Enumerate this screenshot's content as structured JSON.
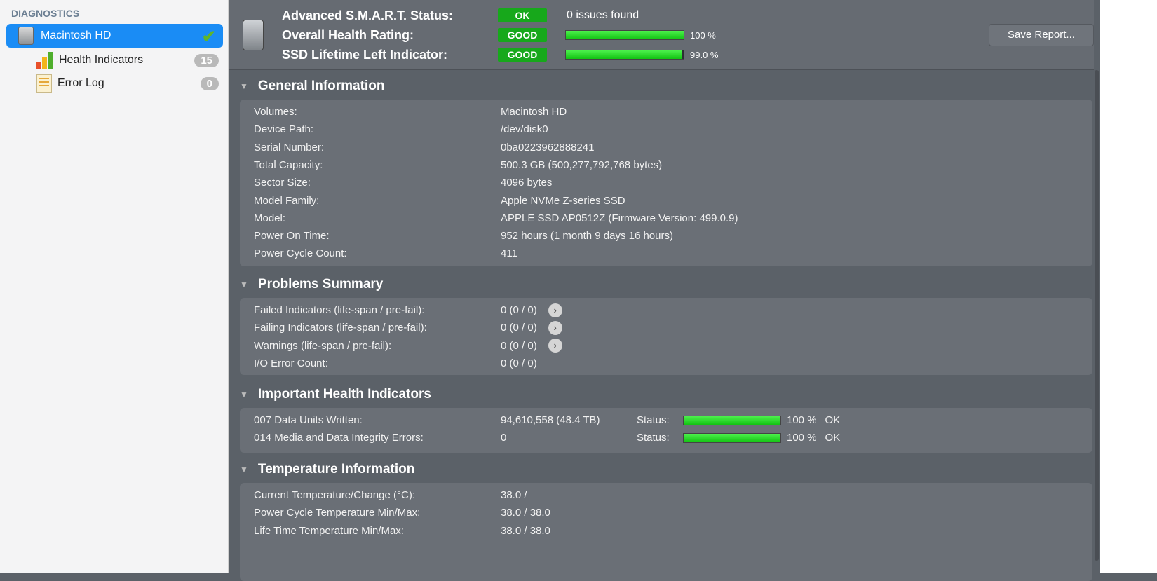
{
  "sidebar": {
    "heading": "DIAGNOSTICS",
    "disk": "Macintosh HD",
    "items": [
      {
        "label": "Health Indicators",
        "count": "15"
      },
      {
        "label": "Error Log",
        "count": "0"
      }
    ]
  },
  "header": {
    "rows": [
      {
        "label": "Advanced S.M.A.R.T. Status:",
        "status": "OK",
        "text": "0 issues found"
      },
      {
        "label": "Overall Health Rating:",
        "status": "GOOD",
        "percent": 100,
        "pct_text": "100 %"
      },
      {
        "label": "SSD Lifetime Left Indicator:",
        "status": "GOOD",
        "percent": 99,
        "pct_text": "99.0 %"
      }
    ],
    "save_label": "Save Report..."
  },
  "sections": [
    {
      "title": "General Information",
      "rows": [
        {
          "k": "Volumes:",
          "v": "Macintosh HD"
        },
        {
          "k": "Device Path:",
          "v": "/dev/disk0"
        },
        {
          "k": "Serial Number:",
          "v": "0ba0223962888241"
        },
        {
          "k": "Total Capacity:",
          "v": "500.3 GB (500,277,792,768 bytes)"
        },
        {
          "k": "Sector Size:",
          "v": "4096 bytes"
        },
        {
          "k": "Model Family:",
          "v": "Apple NVMe Z-series SSD"
        },
        {
          "k": "Model:",
          "v": "APPLE SSD AP0512Z  (Firmware Version: 499.0.9)"
        },
        {
          "k": "Power On Time:",
          "v": "952 hours (1 month 9 days 16 hours)"
        },
        {
          "k": "Power Cycle Count:",
          "v": "411"
        }
      ]
    },
    {
      "title": "Problems Summary",
      "rows": [
        {
          "k": "Failed Indicators (life-span / pre-fail):",
          "v": "0 (0 / 0)",
          "arrow": true
        },
        {
          "k": "Failing Indicators (life-span / pre-fail):",
          "v": "0 (0 / 0)",
          "arrow": true
        },
        {
          "k": "Warnings (life-span / pre-fail):",
          "v": "0 (0 / 0)",
          "arrow": true
        },
        {
          "k": "I/O Error Count:",
          "v": "0 (0 / 0)"
        }
      ]
    },
    {
      "title": "Important Health Indicators",
      "rows": [
        {
          "k": "007  Data Units Written:",
          "v": "94,610,558 (48.4 TB)",
          "status_label": "Status:",
          "percent": 100,
          "pct_text": "100 %",
          "state": "OK"
        },
        {
          "k": "014  Media and Data Integrity Errors:",
          "v": "0",
          "status_label": "Status:",
          "percent": 100,
          "pct_text": "100 %",
          "state": "OK"
        }
      ]
    },
    {
      "title": "Temperature Information",
      "rows": [
        {
          "k": "Current Temperature/Change (°C):",
          "v": "38.0 /"
        },
        {
          "k": "Power Cycle Temperature Min/Max:",
          "v": "38.0 / 38.0"
        },
        {
          "k": "Life Time Temperature Min/Max:",
          "v": "38.0 / 38.0"
        }
      ]
    }
  ]
}
